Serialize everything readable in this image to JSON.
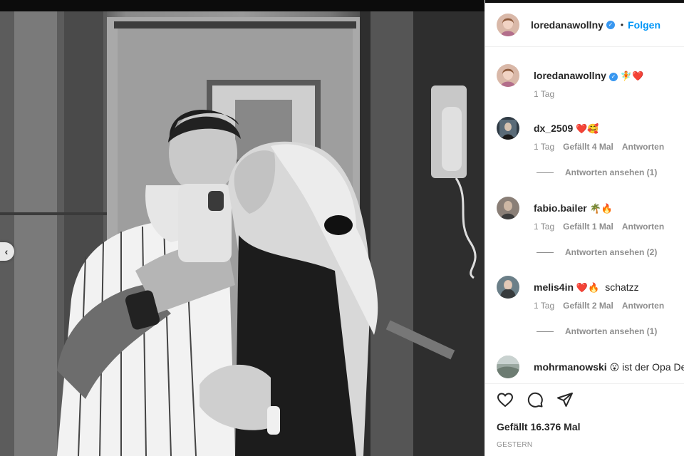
{
  "post": {
    "author": "loredanawollny",
    "verified": true,
    "separator": "•",
    "follow_label": "Folgen",
    "caption": {
      "username": "loredanawollny",
      "emojis": "🧚❤️",
      "time": "1 Tag"
    }
  },
  "comments": [
    {
      "username": "dx_2509",
      "text": "",
      "emojis": "❤️🥰",
      "time": "1 Tag",
      "likes": "Gefällt 4 Mal",
      "reply": "Antworten",
      "view_replies": "Antworten ansehen (1)"
    },
    {
      "username": "fabio.bailer",
      "text": "",
      "emojis": "🌴🔥",
      "time": "1 Tag",
      "likes": "Gefällt 1 Mal",
      "reply": "Antworten",
      "view_replies": "Antworten ansehen (2)"
    },
    {
      "username": "melis4in",
      "text": "schatzz",
      "emojis": "❤️🔥",
      "time": "1 Tag",
      "likes": "Gefällt 2 Mal",
      "reply": "Antworten",
      "view_replies": "Antworten ansehen (1)"
    },
    {
      "username": "mohrmanowski",
      "text": "ist der Opa De",
      "emojis": "😮",
      "time": "",
      "likes": "",
      "reply": "",
      "view_replies": ""
    }
  ],
  "footer": {
    "likes": "Gefällt 16.376 Mal",
    "date": "GESTERN"
  },
  "icons": {
    "like": "heart-icon",
    "comment": "comment-icon",
    "share": "share-icon",
    "prev": "chevron-left-icon",
    "verified": "verified-badge-icon"
  },
  "colors": {
    "accent": "#0095f6",
    "verified": "#3897f0",
    "muted": "#8e8e8e",
    "text": "#262626"
  }
}
